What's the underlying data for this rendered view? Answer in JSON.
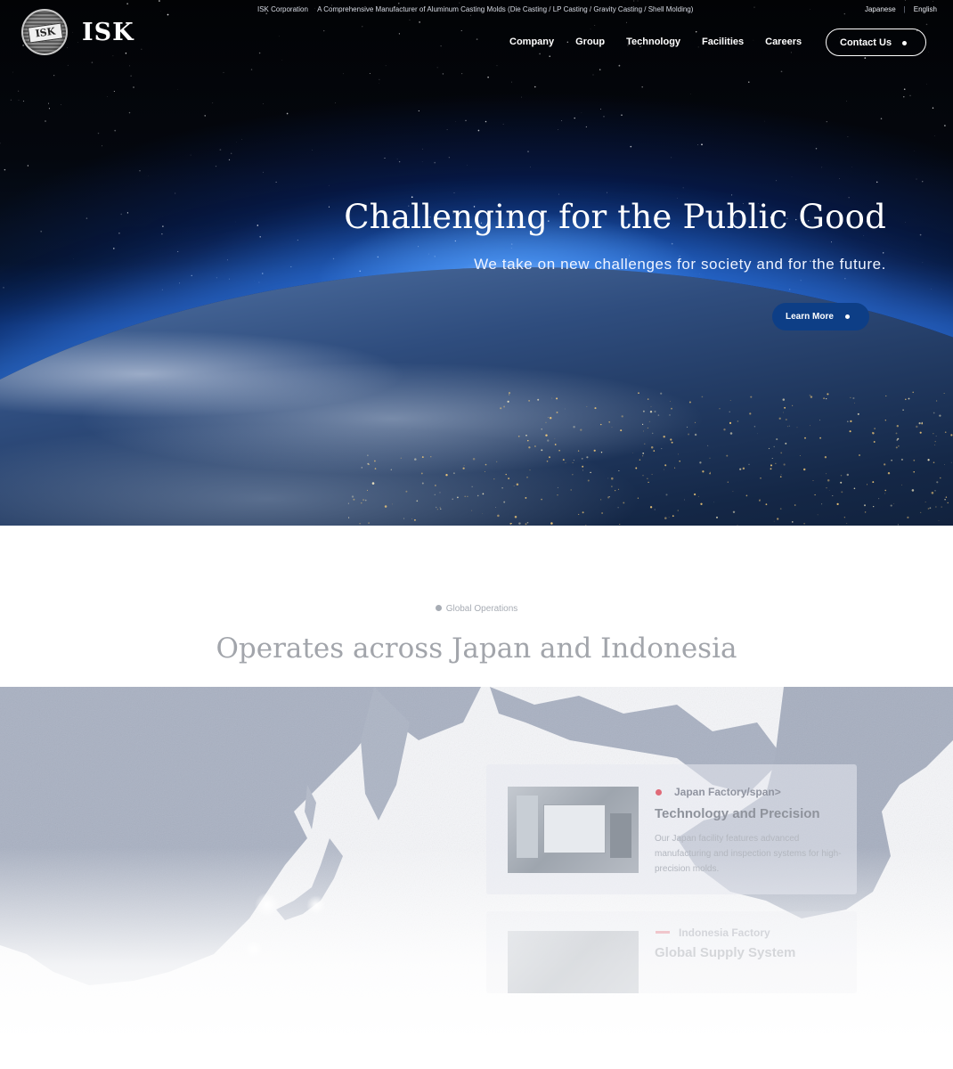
{
  "header": {
    "company": "ISK Corporation",
    "tagline": "A Comprehensive Manufacturer of Aluminum Casting Molds (Die Casting / LP Casting / Gravity Casting / Shell Molding)",
    "languages": [
      "Japanese",
      "English"
    ],
    "logo_text": "ISK",
    "logo_badge_text": "ISK",
    "nav": [
      "Company",
      "Group",
      "Technology",
      "Facilities",
      "Careers"
    ],
    "contact_label": "Contact Us"
  },
  "hero": {
    "title": "Challenging for the Public Good",
    "subtitle": "We take on new challenges for society and for the future.",
    "cta_label": "Learn More"
  },
  "global": {
    "label": "Global Operations",
    "title": "Operates across Japan and Indonesia",
    "cards": [
      {
        "tag": "Japan Factory/span>",
        "title": "Technology and Precision",
        "description": "Our Japan facility features advanced manufacturing and inspection systems for high-precision molds."
      },
      {
        "tag": "Indonesia Factory",
        "title": "Global Supply System",
        "description": ""
      }
    ]
  },
  "colors": {
    "accent_blue": "#0d3e86",
    "accent_red": "#e06a78"
  }
}
